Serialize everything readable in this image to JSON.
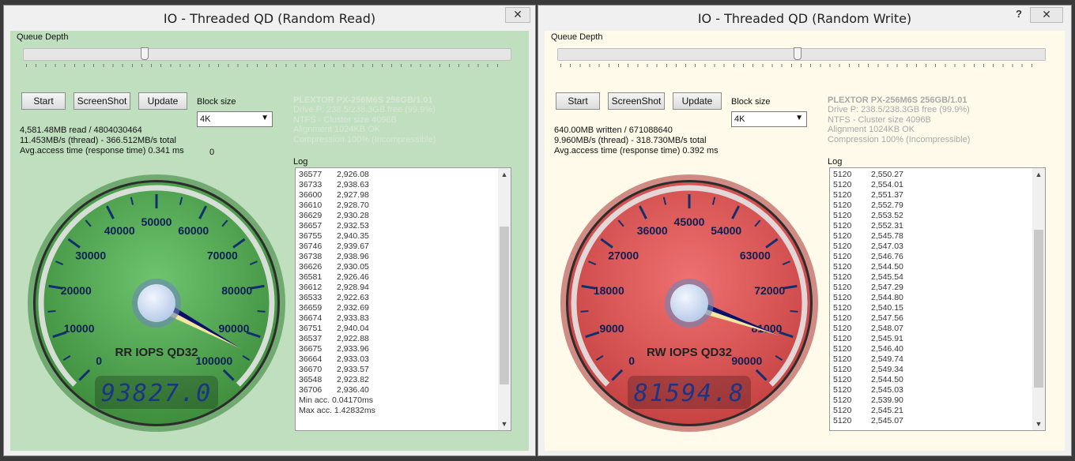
{
  "windows": {
    "left": {
      "title": "IO - Threaded QD (Random Read)",
      "close_label": "✕",
      "queue_depth_label": "Queue Depth",
      "queue_depth_fraction": 0.25,
      "buttons": {
        "start": "Start",
        "screenshot": "ScreenShot",
        "update": "Update"
      },
      "block_size_label": "Block size",
      "block_size_value": "4K",
      "stats": {
        "line1": "4,581.48MB read / 4804030464",
        "line2": "11.453MB/s (thread) - 366.512MB/s total",
        "line3": "Avg.access time (response time) 0.341 ms",
        "zero": "0"
      },
      "device": {
        "name": "PLEXTOR PX-256M6S 256GB/1.01",
        "line1": "Drive P: 238.5/238.3GB free (99.9%)",
        "line2": "NTFS - Cluster size 4096B",
        "line3": "Alignment 1024KB OK",
        "line4": "Compression 100% (Incompressible)"
      },
      "log_label": "Log",
      "log_rows": [
        [
          "36577",
          "2,926.08"
        ],
        [
          "36733",
          "2,938.63"
        ],
        [
          "36600",
          "2,927.98"
        ],
        [
          "36610",
          "2,928.70"
        ],
        [
          "36629",
          "2,930.28"
        ],
        [
          "36657",
          "2,932.53"
        ],
        [
          "36755",
          "2,940.35"
        ],
        [
          "36746",
          "2,939.67"
        ],
        [
          "36738",
          "2,938.96"
        ],
        [
          "36626",
          "2,930.05"
        ],
        [
          "36581",
          "2,926.46"
        ],
        [
          "36612",
          "2,928.94"
        ],
        [
          "36533",
          "2,922.63"
        ],
        [
          "36659",
          "2,932.69"
        ],
        [
          "36674",
          "2,933.83"
        ],
        [
          "36751",
          "2,940.04"
        ],
        [
          "36537",
          "2,922.88"
        ],
        [
          "36675",
          "2,933.96"
        ],
        [
          "36664",
          "2,933.03"
        ],
        [
          "36670",
          "2,933.57"
        ],
        [
          "36548",
          "2,923.82"
        ],
        [
          "36706",
          "2,936.40"
        ]
      ],
      "log_footer": [
        "Min acc. 0.04170ms",
        "Max acc. 1.42832ms"
      ],
      "scroll_fraction": 0.58,
      "gauge": {
        "ticks": [
          "0",
          "10000",
          "20000",
          "30000",
          "40000",
          "50000",
          "60000",
          "70000",
          "80000",
          "90000",
          "100000"
        ],
        "max": 100000,
        "value": 93827.0,
        "label": "RR IOPS QD32",
        "display": "93827.0"
      },
      "colors": {
        "dial": "#3e8e3e",
        "dial_light": "#6ec46e",
        "rim": "#2f7d2f",
        "bg": "#bfdfbf"
      }
    },
    "right": {
      "title": "IO - Threaded QD (Random Write)",
      "help_label": "?",
      "close_label": "✕",
      "queue_depth_label": "Queue Depth",
      "queue_depth_fraction": 0.5,
      "buttons": {
        "start": "Start",
        "screenshot": "ScreenShot",
        "update": "Update"
      },
      "block_size_label": "Block size",
      "block_size_value": "4K",
      "stats": {
        "line1": "640.00MB written / 671088640",
        "line2": "9.960MB/s (thread) - 318.730MB/s total",
        "line3": "Avg.access time (response time) 0.392 ms"
      },
      "device": {
        "name": "PLEXTOR PX-256M6S 256GB/1.01",
        "line1": "Drive P: 238.5/238.3GB free (99.9%)",
        "line2": "NTFS - Cluster size 4096B",
        "line3": "Alignment 1024KB OK",
        "line4": "Compression 100% (Incompressible)"
      },
      "log_label": "Log",
      "log_rows": [
        [
          "5120",
          "2,550.27"
        ],
        [
          "5120",
          "2,554.01"
        ],
        [
          "5120",
          "2,551.37"
        ],
        [
          "5120",
          "2,552.79"
        ],
        [
          "5120",
          "2,553.52"
        ],
        [
          "5120",
          "2,552.31"
        ],
        [
          "5120",
          "2,545.78"
        ],
        [
          "5120",
          "2,547.03"
        ],
        [
          "5120",
          "2,546.76"
        ],
        [
          "5120",
          "2,544.50"
        ],
        [
          "5120",
          "2,545.54"
        ],
        [
          "5120",
          "2,547.29"
        ],
        [
          "5120",
          "2,544.80"
        ],
        [
          "5120",
          "2,540.15"
        ],
        [
          "5120",
          "2,547.56"
        ],
        [
          "5120",
          "2,548.07"
        ],
        [
          "5120",
          "2,545.91"
        ],
        [
          "5120",
          "2,546.40"
        ],
        [
          "5120",
          "2,549.74"
        ],
        [
          "5120",
          "2,549.34"
        ],
        [
          "5120",
          "2,544.50"
        ],
        [
          "5120",
          "2,545.03"
        ],
        [
          "5120",
          "2,539.90"
        ],
        [
          "5120",
          "2,545.21"
        ],
        [
          "5120",
          "2,545.07"
        ]
      ],
      "log_footer": [],
      "scroll_fraction": 0.62,
      "gauge": {
        "ticks": [
          "0",
          "9000",
          "18000",
          "27000",
          "36000",
          "45000",
          "54000",
          "63000",
          "72000",
          "81000",
          "90000"
        ],
        "max": 90000,
        "value": 81594.8,
        "label": "RW IOPS QD32",
        "display": "81594.8"
      },
      "colors": {
        "dial": "#c84444",
        "dial_light": "#ee7070",
        "rim": "#a83030",
        "bg": "#fffaea"
      }
    }
  }
}
